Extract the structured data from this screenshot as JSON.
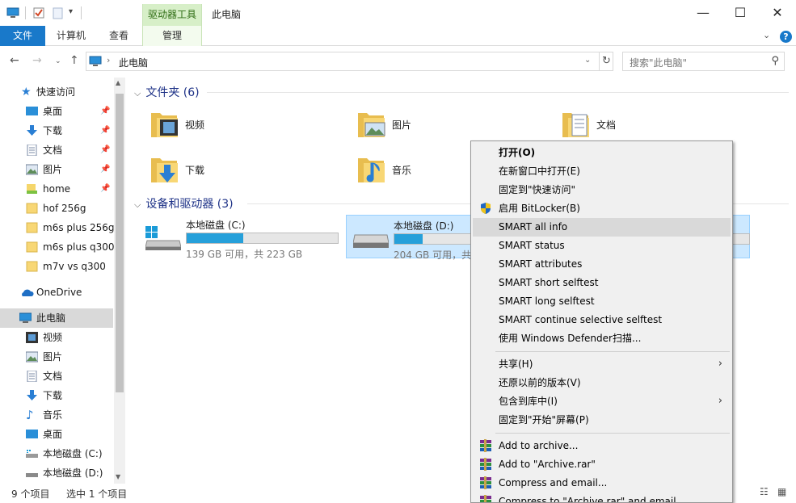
{
  "window": {
    "title": "此电脑",
    "context_tab_header": "驱动器工具",
    "minimize": "—",
    "maximize": "☐",
    "close": "✕"
  },
  "ribbon": {
    "tabs": [
      "文件",
      "计算机",
      "查看",
      "管理"
    ],
    "help": "?"
  },
  "address": {
    "crumb": "此电脑",
    "search_placeholder": "搜索\"此电脑\""
  },
  "sidebar": {
    "quick_access": "快速访问",
    "quick_items": [
      {
        "label": "桌面",
        "icon": "desktop-icon",
        "pinned": true
      },
      {
        "label": "下载",
        "icon": "download-icon",
        "pinned": true
      },
      {
        "label": "文档",
        "icon": "document-icon",
        "pinned": true
      },
      {
        "label": "图片",
        "icon": "picture-icon",
        "pinned": true
      },
      {
        "label": "home",
        "icon": "folder-icon",
        "pinned": true
      },
      {
        "label": "hof 256g",
        "icon": "folder-icon",
        "pinned": false
      },
      {
        "label": "m6s plus 256g",
        "icon": "folder-icon",
        "pinned": false
      },
      {
        "label": "m6s plus q300",
        "icon": "folder-icon",
        "pinned": false
      },
      {
        "label": "m7v vs q300",
        "icon": "folder-icon",
        "pinned": false
      }
    ],
    "onedrive": "OneDrive",
    "this_pc": "此电脑",
    "pc_items": [
      {
        "label": "视频",
        "icon": "video-icon"
      },
      {
        "label": "图片",
        "icon": "picture-icon"
      },
      {
        "label": "文档",
        "icon": "document-icon"
      },
      {
        "label": "下载",
        "icon": "download-icon"
      },
      {
        "label": "音乐",
        "icon": "music-icon"
      },
      {
        "label": "桌面",
        "icon": "desktop-icon"
      },
      {
        "label": "本地磁盘 (C:)",
        "icon": "drive-icon"
      },
      {
        "label": "本地磁盘 (D:)",
        "icon": "drive-icon"
      }
    ]
  },
  "content": {
    "folders_header": "文件夹 (6)",
    "folders": [
      {
        "label": "视频",
        "icon": "video-folder-icon"
      },
      {
        "label": "图片",
        "icon": "picture-folder-icon"
      },
      {
        "label": "文档",
        "icon": "document-folder-icon"
      },
      {
        "label": "下载",
        "icon": "download-folder-icon"
      },
      {
        "label": "音乐",
        "icon": "music-folder-icon"
      }
    ],
    "drives_header": "设备和驱动器 (3)",
    "drives": [
      {
        "label": "本地磁盘 (C:)",
        "free": "139 GB 可用，共 223 GB",
        "used_fraction": 0.377,
        "selected": false
      },
      {
        "label": "本地磁盘 (D:)",
        "free": "204 GB 可用，共",
        "used_fraction": 0.08,
        "selected": true
      }
    ]
  },
  "status": {
    "count": "9 个项目",
    "selected": "选中 1 个项目"
  },
  "context_menu": {
    "items": [
      {
        "label": "打开(O)",
        "bold": true
      },
      {
        "label": "在新窗口中打开(E)"
      },
      {
        "label": "固定到\"快速访问\""
      },
      {
        "label": "启用 BitLocker(B)",
        "icon": "shield-icon"
      },
      {
        "label": "SMART all info",
        "highlight": true
      },
      {
        "label": "SMART status"
      },
      {
        "label": "SMART attributes"
      },
      {
        "label": "SMART short selftest"
      },
      {
        "label": "SMART long selftest"
      },
      {
        "label": "SMART continue selective selftest"
      },
      {
        "label": "使用 Windows Defender扫描..."
      },
      {
        "sep": true
      },
      {
        "label": "共享(H)",
        "submenu": true
      },
      {
        "label": "还原以前的版本(V)"
      },
      {
        "label": "包含到库中(I)",
        "submenu": true
      },
      {
        "label": "固定到\"开始\"屏幕(P)"
      },
      {
        "sep": true
      },
      {
        "label": "Add to archive...",
        "icon": "winrar-icon"
      },
      {
        "label": "Add to \"Archive.rar\"",
        "icon": "winrar-icon"
      },
      {
        "label": "Compress and email...",
        "icon": "winrar-icon"
      },
      {
        "label": "Compress to \"Archive.rar\" and email",
        "icon": "winrar-icon"
      }
    ]
  },
  "colors": {
    "accent": "#1979ca",
    "context_tab": "#d7efc8",
    "drive_fill": "#26a0da",
    "selection": "#cce8ff",
    "group_header": "#1e3287"
  }
}
